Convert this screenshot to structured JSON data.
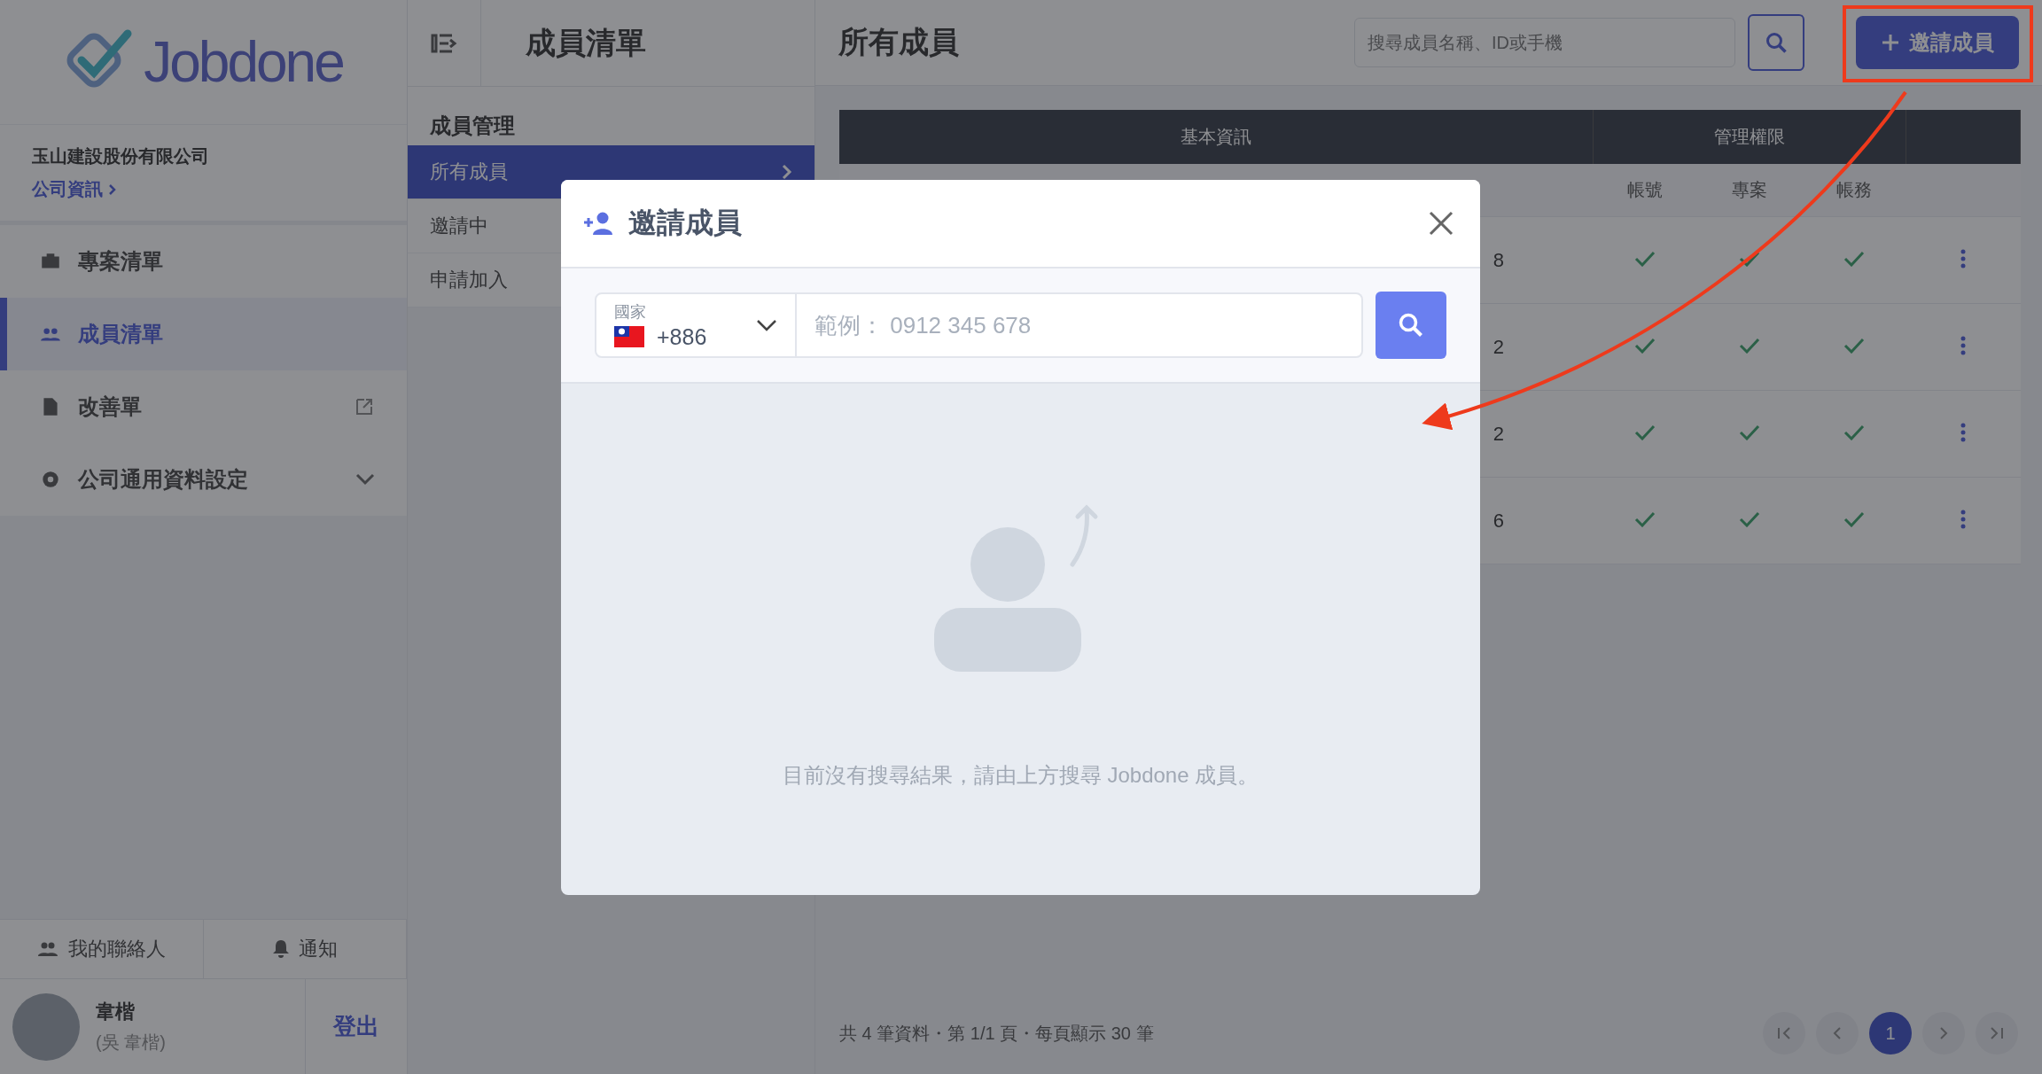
{
  "sidebar": {
    "logo_text": "Jobdone",
    "company": "玉山建設股份有限公司",
    "company_link": "公司資訊",
    "nav": [
      {
        "label": "專案清單",
        "selected": false,
        "kind": "plain"
      },
      {
        "label": "成員清單",
        "selected": true,
        "kind": "plain"
      },
      {
        "label": "改善單",
        "selected": false,
        "kind": "external"
      },
      {
        "label": "公司通用資料設定",
        "selected": false,
        "kind": "chevron"
      }
    ],
    "footer_tabs": [
      {
        "label": "我的聯絡人"
      },
      {
        "label": "通知"
      }
    ],
    "user": {
      "name": "韋楷",
      "subtitle": "(吳 韋楷)"
    },
    "logout": "登出"
  },
  "subnav": {
    "title": "成員清單",
    "group": "成員管理",
    "items": [
      {
        "label": "所有成員",
        "selected": true
      },
      {
        "label": "邀請中",
        "selected": false
      },
      {
        "label": "申請加入",
        "selected": false
      }
    ]
  },
  "main": {
    "title": "所有成員",
    "search": {
      "placeholder": "搜尋成員名稱、ID或手機"
    },
    "invite_button": "邀請成員",
    "table": {
      "groups": [
        "基本資訊",
        "管理權限"
      ],
      "permission_columns": [
        "帳號",
        "專案",
        "帳務"
      ],
      "rows": [
        {
          "column_1": "8",
          "permissions": [
            true,
            true,
            true
          ]
        },
        {
          "column_1": "2",
          "permissions": [
            true,
            true,
            true
          ]
        },
        {
          "column_1": "2",
          "permissions": [
            true,
            true,
            true
          ]
        },
        {
          "column_1": "6",
          "permissions": [
            true,
            true,
            true
          ]
        }
      ]
    },
    "footer": {
      "summary": "共 4 筆資料・第 1/1 頁・每頁顯示 30 筆",
      "pages": [
        {
          "label": "1",
          "selected": true
        }
      ]
    }
  },
  "modal": {
    "title": "邀請成員",
    "country": {
      "label": "國家",
      "code": "+886"
    },
    "phone": {
      "placeholder": "範例： 0912 345 678"
    },
    "empty_message": "目前沒有搜尋結果，請由上方搜尋 Jobdone 成員。"
  }
}
